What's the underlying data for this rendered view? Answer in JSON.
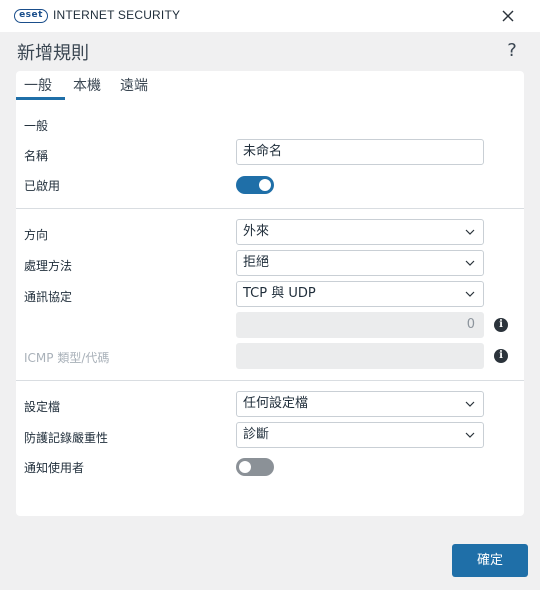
{
  "titlebar": {
    "logo_text": "eset",
    "product_name": "INTERNET SECURITY"
  },
  "dialog": {
    "title": "新增規則",
    "help_label": "?"
  },
  "tabs": [
    {
      "label": "一般",
      "active": true
    },
    {
      "label": "本機",
      "active": false
    },
    {
      "label": "遠端",
      "active": false
    }
  ],
  "general": {
    "section_label": "一般",
    "name_label": "名稱",
    "name_value": "未命名",
    "enabled_label": "已啟用",
    "enabled": true
  },
  "traffic": {
    "direction_label": "方向",
    "direction_value": "外來",
    "action_label": "處理方法",
    "action_value": "拒絕",
    "protocol_label": "通訊協定",
    "protocol_value": "TCP 與 UDP",
    "port_value": "0",
    "icmp_label": "ICMP 類型/代碼"
  },
  "profile": {
    "profile_label": "設定檔",
    "profile_value": "任何設定檔",
    "log_label": "防護記錄嚴重性",
    "log_value": "診斷",
    "notify_label": "通知使用者",
    "notify": false
  },
  "footer": {
    "ok_label": "確定"
  },
  "colors": {
    "accent": "#1f6fa8",
    "toggle_off": "#8b9197"
  }
}
